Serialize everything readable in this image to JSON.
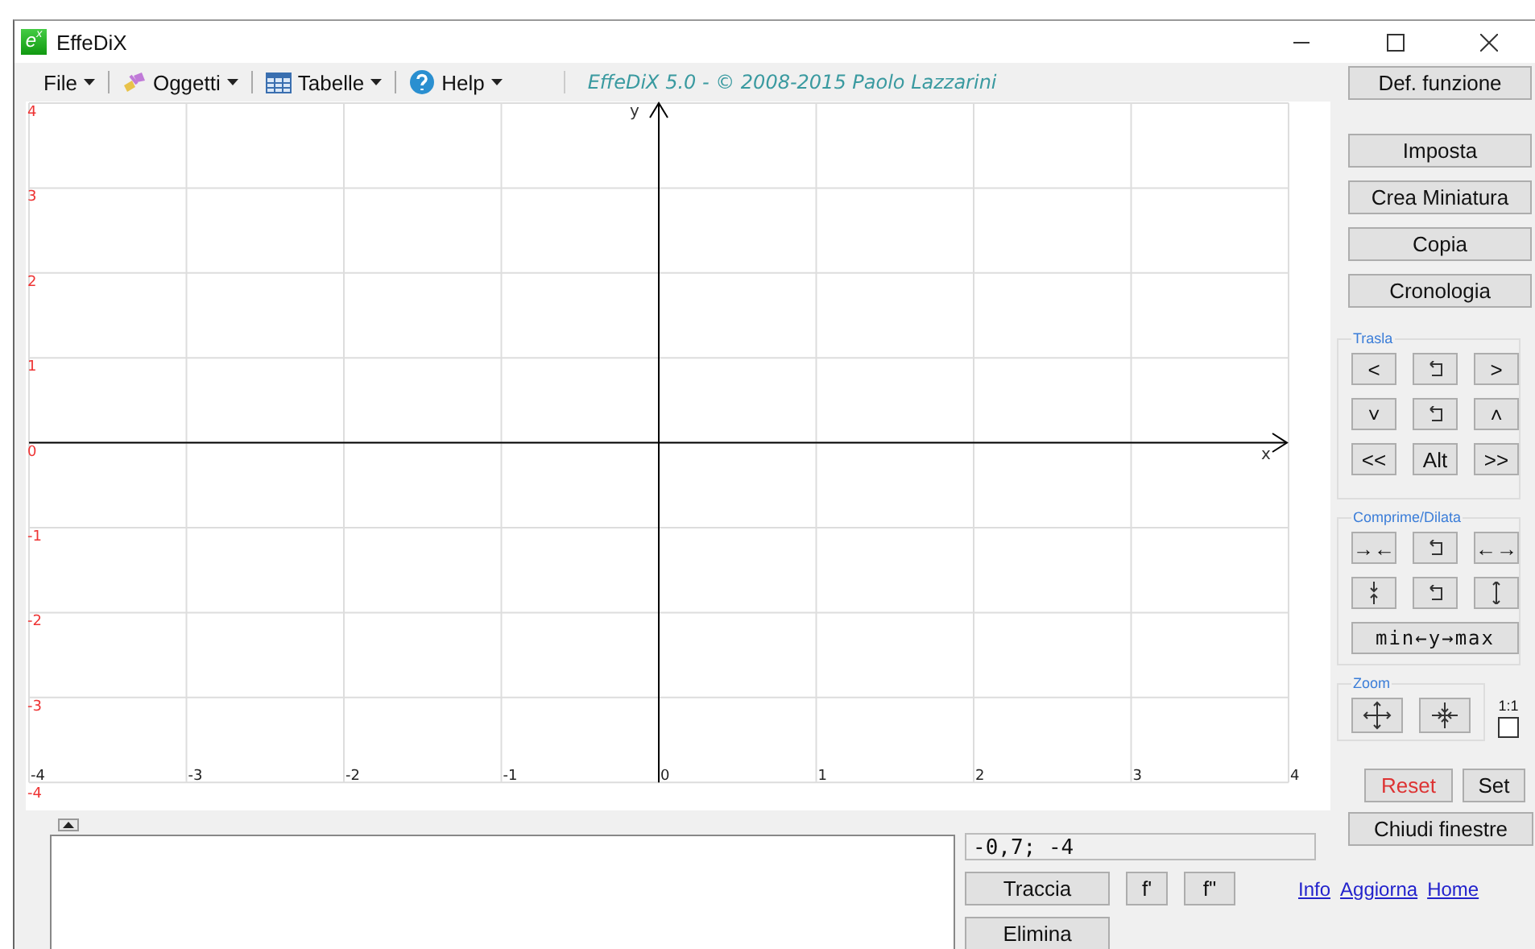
{
  "window": {
    "title": "EffeDiX",
    "logo": {
      "base": "e",
      "exponent": "x"
    }
  },
  "menu": [
    {
      "label": "File"
    },
    {
      "label": "Oggetti"
    },
    {
      "label": "Tabelle"
    },
    {
      "label": "Help"
    }
  ],
  "caption": "EffeDiX 5.0 - © 2008-2015 Paolo Lazzarini",
  "plot": {
    "x_axis_label": "x",
    "y_axis_label": "y",
    "y_tick_labels": [
      "4",
      "3",
      "2",
      "1",
      "0",
      "-1",
      "-2",
      "-3",
      "-4"
    ],
    "x_tick_labels": [
      "-4",
      "-3",
      "-2",
      "-1",
      "0",
      "1",
      "2",
      "3",
      "4"
    ]
  },
  "side_buttons": [
    "Def. funzione",
    "Imposta",
    "Crea Miniatura",
    "Copia",
    "Cronologia"
  ],
  "trasla": {
    "title": "Trasla",
    "rows": [
      [
        {
          "kind": "text",
          "label": "<"
        },
        {
          "kind": "reset"
        },
        {
          "kind": "text",
          "label": ">"
        }
      ],
      [
        {
          "kind": "text",
          "label": "˅"
        },
        {
          "kind": "reset"
        },
        {
          "kind": "text",
          "label": "˄"
        }
      ],
      [
        {
          "kind": "text",
          "label": "<<"
        },
        {
          "kind": "text",
          "label": "Alt"
        },
        {
          "kind": "text",
          "label": ">>"
        }
      ]
    ]
  },
  "comprime": {
    "title": "Comprime/Dilata",
    "rows": [
      [
        {
          "kind": "text",
          "label": "→←"
        },
        {
          "kind": "reset"
        },
        {
          "kind": "text",
          "label": "←→"
        }
      ],
      [
        {
          "kind": "squeeze"
        },
        {
          "kind": "reset"
        },
        {
          "kind": "stretch"
        }
      ]
    ],
    "range_button": "min←y→max"
  },
  "zoom": {
    "title": "Zoom",
    "buttons": [
      {
        "kind": "expand"
      },
      {
        "kind": "contract"
      }
    ],
    "ratio_label": "1:1",
    "ratio_checked": false
  },
  "reset_button": "Reset",
  "set_button": "Set",
  "close_windows_button": "Chiudi finestre",
  "coordinates": "-0,7; -4",
  "draw_button": "Traccia",
  "derivative_buttons": [
    "f'",
    "f\""
  ],
  "delete_button": "Elimina",
  "links": [
    "Info",
    "Aggiorna",
    "Home"
  ]
}
